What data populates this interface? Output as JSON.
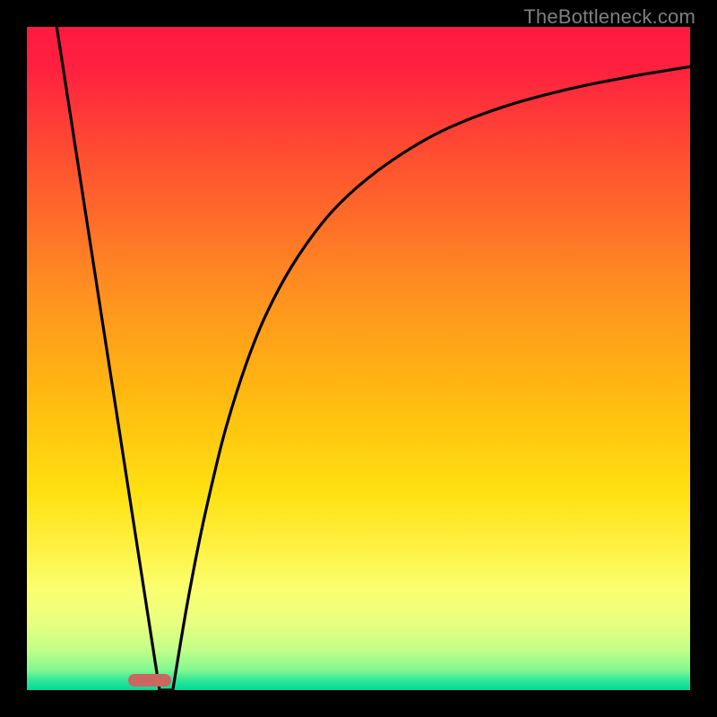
{
  "watermark": {
    "text": "TheBottleneck.com"
  },
  "colors": {
    "black": "#000000",
    "gradient_stops": [
      {
        "offset": 0.0,
        "color": "#ff1a40"
      },
      {
        "offset": 0.06,
        "color": "#ff2040"
      },
      {
        "offset": 0.2,
        "color": "#ff5030"
      },
      {
        "offset": 0.4,
        "color": "#ff9020"
      },
      {
        "offset": 0.55,
        "color": "#ffb810"
      },
      {
        "offset": 0.7,
        "color": "#ffe010"
      },
      {
        "offset": 0.78,
        "color": "#fff040"
      },
      {
        "offset": 0.85,
        "color": "#faff70"
      },
      {
        "offset": 0.9,
        "color": "#e8ff80"
      },
      {
        "offset": 0.94,
        "color": "#c0ff88"
      },
      {
        "offset": 0.97,
        "color": "#80f890"
      },
      {
        "offset": 0.985,
        "color": "#30e898"
      },
      {
        "offset": 1.0,
        "color": "#00d89a"
      }
    ],
    "curve_stroke": "#000000",
    "marker_fill": "#cc6660"
  },
  "marker": {
    "x_frac": 0.185,
    "y_frac": 0.985,
    "width_frac": 0.065,
    "height_frac": 0.018
  },
  "chart_data": {
    "type": "line",
    "title": "",
    "xlabel": "",
    "ylabel": "",
    "xlim": [
      0,
      1
    ],
    "ylim": [
      0,
      1
    ],
    "series": [
      {
        "name": "left-line",
        "x": [
          0.045,
          0.2
        ],
        "y": [
          1.0,
          0.0
        ]
      },
      {
        "name": "right-curve",
        "x": [
          0.22,
          0.24,
          0.26,
          0.28,
          0.3,
          0.33,
          0.36,
          0.4,
          0.45,
          0.5,
          0.56,
          0.63,
          0.72,
          0.82,
          0.91,
          1.0
        ],
        "y": [
          0.0,
          0.12,
          0.225,
          0.315,
          0.395,
          0.49,
          0.565,
          0.64,
          0.71,
          0.76,
          0.805,
          0.845,
          0.88,
          0.907,
          0.925,
          0.94
        ]
      }
    ],
    "annotations": [
      {
        "type": "marker",
        "x": 0.205,
        "y": 0.0,
        "label": "optimal-zone"
      }
    ]
  }
}
